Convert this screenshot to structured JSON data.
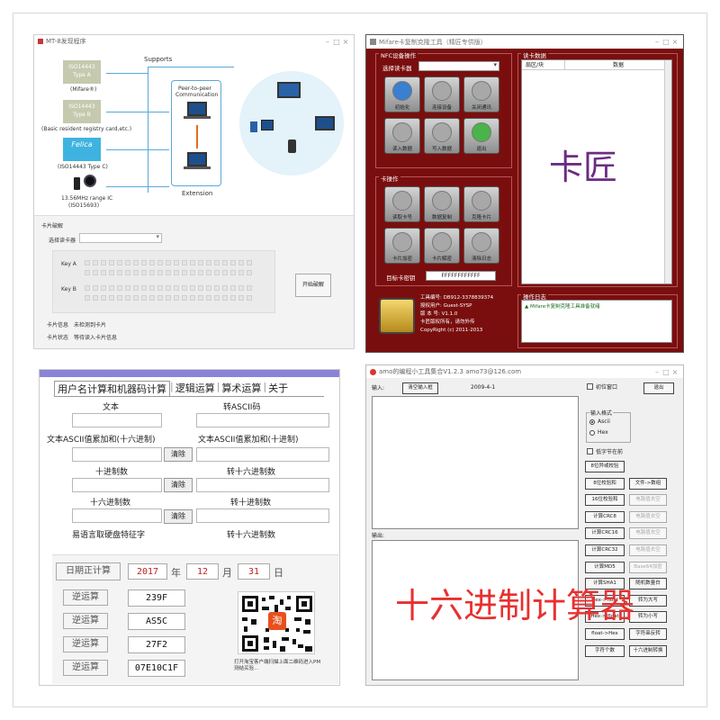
{
  "panel1": {
    "window_title": "MT-8发现程序",
    "supports_label": "Supports",
    "chips": [
      {
        "line1": "ISO14443",
        "line2": "Type A",
        "caption": "(Mifare®)"
      },
      {
        "line1": "ISO14443",
        "line2": "Type B",
        "caption": "(Basic resident registry card,etc.)"
      },
      {
        "line1": "Felica",
        "line2": "",
        "caption": "(ISO14443 Type C)"
      }
    ],
    "rfid_caption_1": "13.56MHz range IC",
    "rfid_caption_2": "(ISO15693)",
    "p2p_line1": "Peer-to-peer",
    "p2p_line2": "Communication",
    "extension_label": "Extension",
    "section_label": "卡片破解",
    "reader_label": "选择读卡器",
    "key_a_label": "Key A",
    "key_b_label": "Key B",
    "crack_button": "开始破解",
    "card_info_label": "卡片信息",
    "card_info_value": "未检测到卡片",
    "card_status_label": "卡片状态",
    "card_status_value": "等待读入卡片信息"
  },
  "panel2": {
    "window_title": "Mifare卡复制克隆工具（精匠专供版）",
    "nfc_group_label": "NFC设备操作",
    "reader_label": "选择读卡器",
    "tiles_top": [
      "初始化",
      "连接设备",
      "关闭通讯",
      "读入数据",
      "写入数据",
      "退出"
    ],
    "card_group_label": "卡操作",
    "tiles_bottom": [
      "读取卡号",
      "数据复制",
      "克隆卡片",
      "卡片加密",
      "卡片解密",
      "清除日志"
    ],
    "sector_label": "目标卡密钥",
    "sector_value": "FFFFFFFFFFFF",
    "data_group_label": "读卡数据",
    "col_sector": "扇区/块",
    "col_data": "数据",
    "watermark": "卡匠",
    "info_lines": [
      "工具编号: DB912-3378839374",
      "授权用户: Guest-SYSP",
      "版 本 号: V1.1.0",
      "卡匠版权所有，请勿外传",
      "CopyRight (c) 2011-2013"
    ],
    "log_group_label": "操作日志",
    "log_text": "▲ Mifare卡复制克隆工具准备就绪"
  },
  "panel3": {
    "tabs": [
      "用户名计算和机器码计算",
      "逻辑运算",
      "算术运算",
      "关于"
    ],
    "text_label": "文本",
    "ascii_label": "转ASCII码",
    "sum_hex_label": "文本ASCII值累加和(十六进制)",
    "sum_dec_label": "文本ASCII值累加和(十进制)",
    "clear_label": "清除",
    "dec_label": "十进制数",
    "to_hex_label": "转十六进制数",
    "hex_label": "十六进制数",
    "to_dec_label": "转十进制数",
    "easy_label": "易语言取硬盘特征字",
    "to_dec_label_2": "转十六进制数",
    "date_button": "日期正计算",
    "year": "2017",
    "year_unit": "年",
    "month": "12",
    "month_unit": "月",
    "day": "31",
    "day_unit": "日",
    "reverse_label": "逆运算",
    "results": [
      "239F",
      "AS5C",
      "27F2",
      "07E10C1F"
    ],
    "qr_caption": "打开淘宝客户端扫描上面二维码进入PM测结买验…",
    "taobao_icon_text": "淘"
  },
  "panel4": {
    "window_title": "amo的编程小工具集合V1.2.3 amo73@126.com",
    "input_label": "输入:",
    "clear_input": "清空输入框",
    "date_text": "2009-4-1",
    "topmost_label": "初位窗口",
    "exit_label": "退出",
    "format_label": "输入格式",
    "format_ascii": "Ascii",
    "format_hex": "Hex",
    "lowercase_label": "低字节在前",
    "output_label": "输出:",
    "watermark": "十六进制计算器",
    "buttons_left": [
      "8位异或校验",
      "8位校验和",
      "16位校验和",
      "计算CRC8",
      "计算CRC16",
      "计算CRC32",
      "计算MD5",
      "计算SHA1",
      "Hex->float",
      "Hex->Ifloat",
      "float->Hex",
      "字符个数"
    ],
    "buttons_right": [
      "文件->数组",
      "电路值去空",
      "电路值去空",
      "电路值去空",
      "电路值去空",
      "Base64加密",
      "随机数量白",
      "转为大写",
      "转为小写",
      "字符串反转",
      "十六进制转换"
    ]
  }
}
